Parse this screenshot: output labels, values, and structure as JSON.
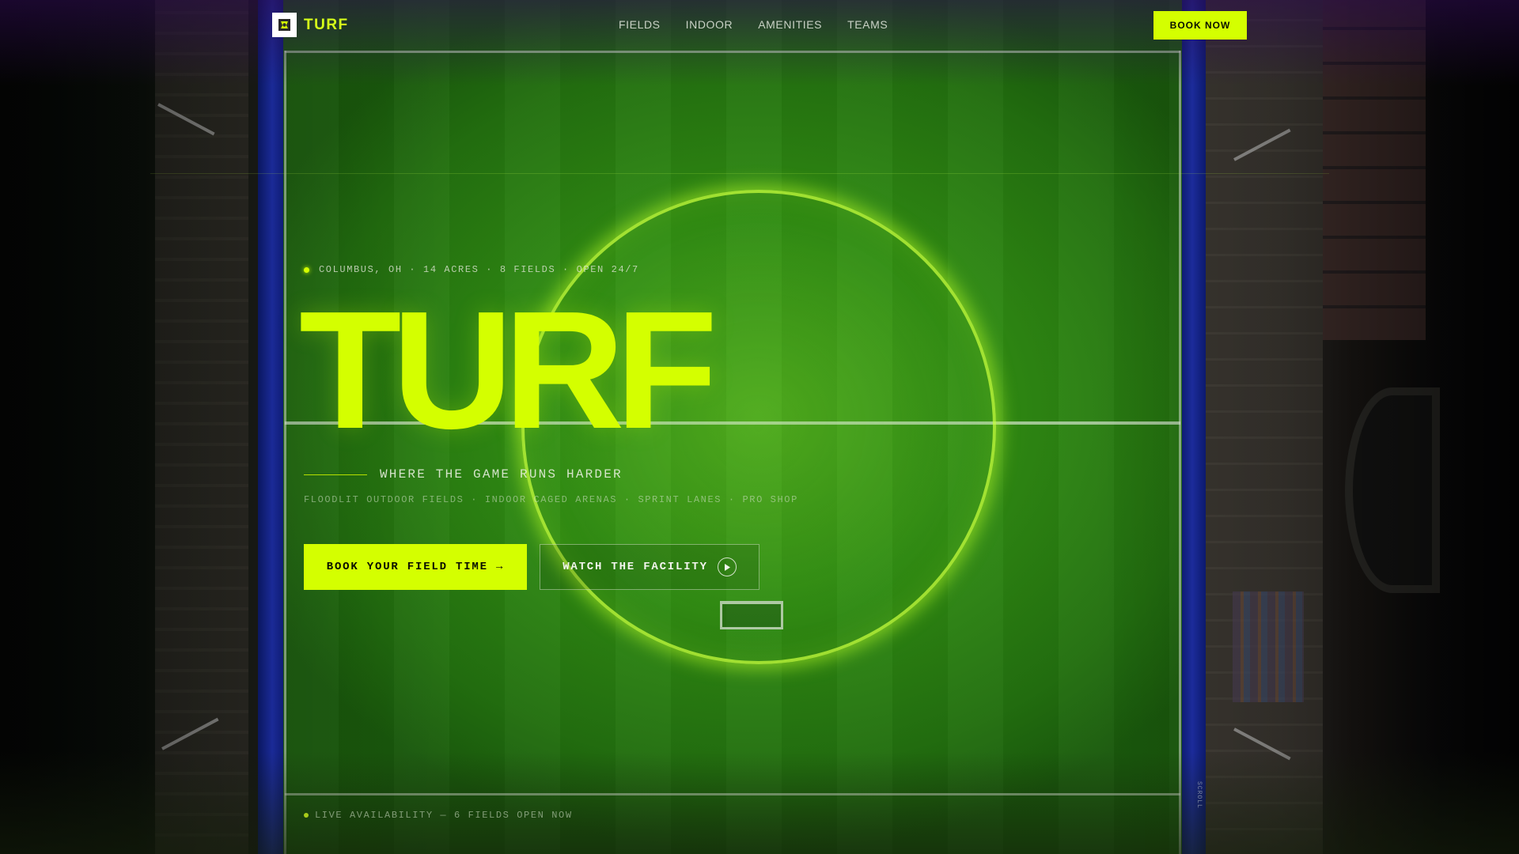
{
  "brand": {
    "name": "TURF",
    "accent": "#d4ff00"
  },
  "nav": {
    "links": [
      "FIELDS",
      "INDOOR",
      "AMENITIES",
      "TEAMS"
    ],
    "cta": "BOOK NOW"
  },
  "hero": {
    "meta": "COLUMBUS, OH · 14 ACRES · 8 FIELDS · OPEN 24/7",
    "title": "TURF",
    "tagline": "WHERE THE GAME RUNS HARDER",
    "features": "FLOODLIT OUTDOOR FIELDS · INDOOR CAGED ARENAS · SPRINT LANES · PRO SHOP",
    "primary_cta": "BOOK YOUR FIELD TIME →",
    "secondary_cta": "WATCH THE FACILITY"
  },
  "status": {
    "live": "LIVE AVAILABILITY — 6 FIELDS OPEN NOW"
  },
  "scroll": "SCROLL",
  "icons": {
    "logo": "turf-logo-icon",
    "play": "play-icon",
    "status": "live-dot-icon"
  }
}
